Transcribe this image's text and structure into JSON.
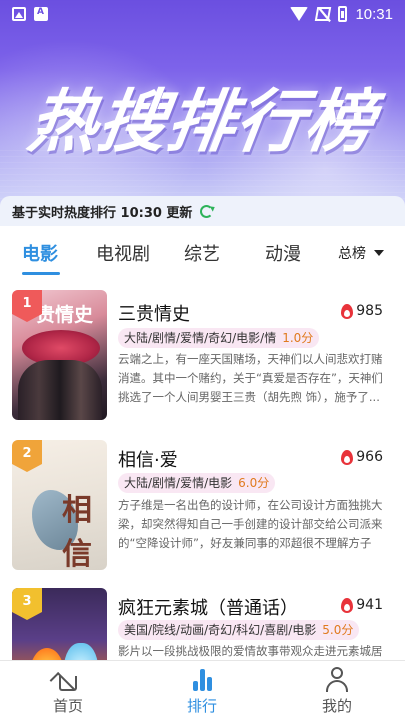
{
  "status_bar": {
    "time": "10:31"
  },
  "banner": {
    "title": "热搜排行榜"
  },
  "update": {
    "text": "基于实时热度排行 10:30 更新"
  },
  "tabs": [
    {
      "label": "电影",
      "active": true
    },
    {
      "label": "电视剧",
      "active": false
    },
    {
      "label": "综艺",
      "active": false
    },
    {
      "label": "动漫",
      "active": false
    }
  ],
  "rank_select": {
    "value": "总榜"
  },
  "list": [
    {
      "rank": "1",
      "badge_color": "#ef5a5a",
      "title": "三贵情史",
      "poster_text": "贵情史",
      "hot": "985",
      "tags": "大陆/剧情/爱情/奇幻/电影/情",
      "score": "1.0分",
      "desc": "云端之上，有一座天国赌场，天神们以人间悲欢打赌消遣。其中一个赌约，关于“真爱是否存在”，天神们挑选了一个人间男婴王三贵（胡先煦 饰），施予了..."
    },
    {
      "rank": "2",
      "badge_color": "#f0a43a",
      "title": "相信·爱",
      "poster_text": "相信",
      "hot": "966",
      "tags": "大陆/剧情/爱情/电影",
      "score": "6.0分",
      "desc": "方子维是一名出色的设计师，在公司设计方面独挑大梁，却突然得知自己一手创建的设计部交给公司派来的“空降设计师”，好友兼同事的邓超很不理解方子维..."
    },
    {
      "rank": "3",
      "badge_color": "#f2c02e",
      "title": "疯狂元素城（普通话）",
      "poster_text": "",
      "hot": "941",
      "tags": "美国/院线/动画/奇幻/科幻/喜剧/电影",
      "score": "5.0分",
      "desc": "影片以一段挑战极限的爱情故事带观众走进元素城居"
    }
  ],
  "bottom_nav": [
    {
      "label": "首页",
      "icon": "home-icon",
      "active": false
    },
    {
      "label": "排行",
      "icon": "chart-icon",
      "active": true
    },
    {
      "label": "我的",
      "icon": "user-icon",
      "active": false
    }
  ],
  "colors": {
    "accent": "#2f8fe0",
    "hot": "#e8333a",
    "score": "#e07a1e",
    "refresh": "#2eb35a"
  }
}
